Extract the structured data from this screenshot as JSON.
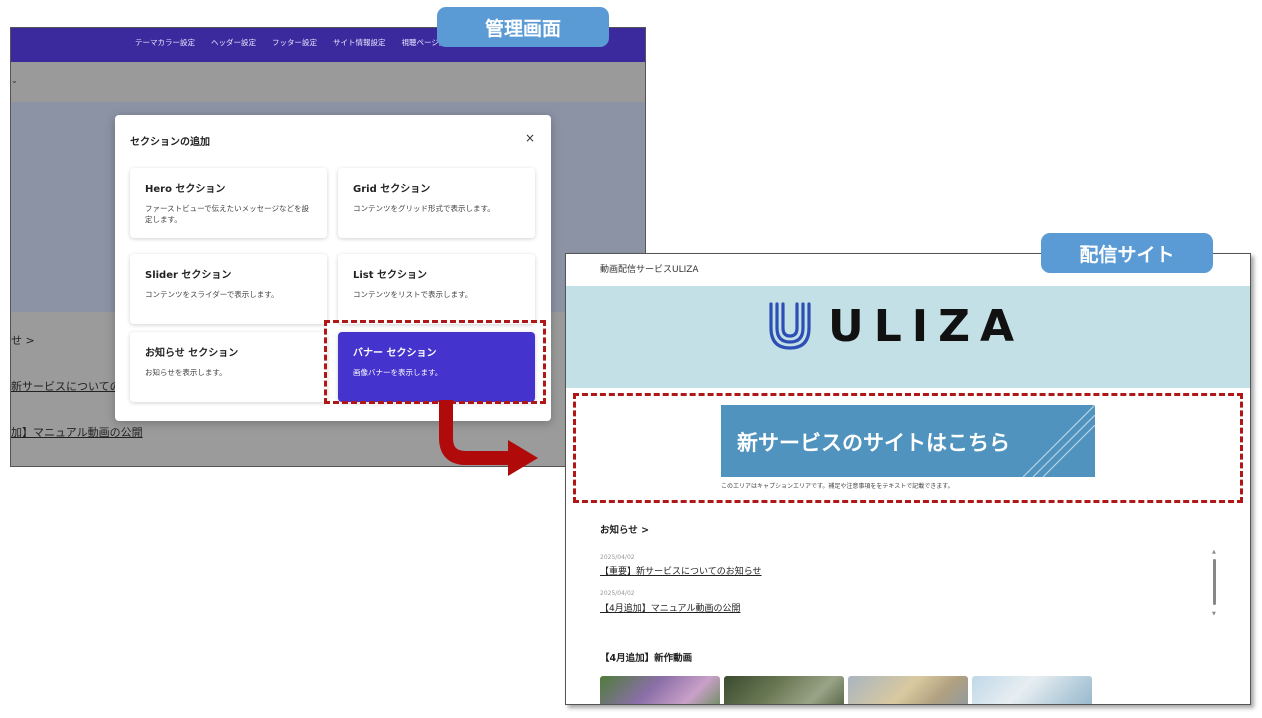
{
  "callouts": {
    "admin": "管理画面",
    "site": "配信サイト"
  },
  "admin": {
    "nav": [
      "テーマカラー設定",
      "ヘッダー設定",
      "フッター設定",
      "サイト情報設定",
      "視聴ページ設定"
    ],
    "behind": {
      "news_label": "せ >",
      "link1": "新サービスについての",
      "link2": "加】マニュアル動画の公開"
    },
    "modal": {
      "title": "セクションの追加",
      "close": "×",
      "cards": [
        {
          "title": "Hero セクション",
          "desc": "ファーストビューで伝えたいメッセージなどを設定します。"
        },
        {
          "title": "Grid セクション",
          "desc": "コンテンツをグリッド形式で表示します。"
        },
        {
          "title": "Slider セクション",
          "desc": "コンテンツをスライダーで表示します。"
        },
        {
          "title": "List セクション",
          "desc": "コンテンツをリストで表示します。"
        },
        {
          "title": "お知らせ セクション",
          "desc": "お知らせを表示します。"
        },
        {
          "title": "バナー セクション",
          "desc": "画像バナーを表示します。"
        }
      ]
    }
  },
  "site": {
    "header": "動画配信サービスULIZA",
    "logo": "ULIZA",
    "banner_text": "新サービスのサイトはこちら",
    "caption": "このエリアはキャプションエリアです。補足や注意事項ををテキストで記載できます。",
    "news": {
      "heading": "お知らせ >",
      "items": [
        {
          "date": "2025/04/02",
          "title": "【重要】新サービスについてのお知らせ"
        },
        {
          "date": "2025/04/02",
          "title": "【4月追加】マニュアル動画の公開"
        }
      ]
    },
    "new_videos_heading": "【4月追加】新作動画"
  },
  "colors": {
    "admin_nav": "#3b2a9e",
    "modal_active": "#4433cc",
    "highlight": "#b01818",
    "callout": "#5b9bd5",
    "hero_bg": "#c3e0e6",
    "banner_bg": "#4f93be"
  }
}
